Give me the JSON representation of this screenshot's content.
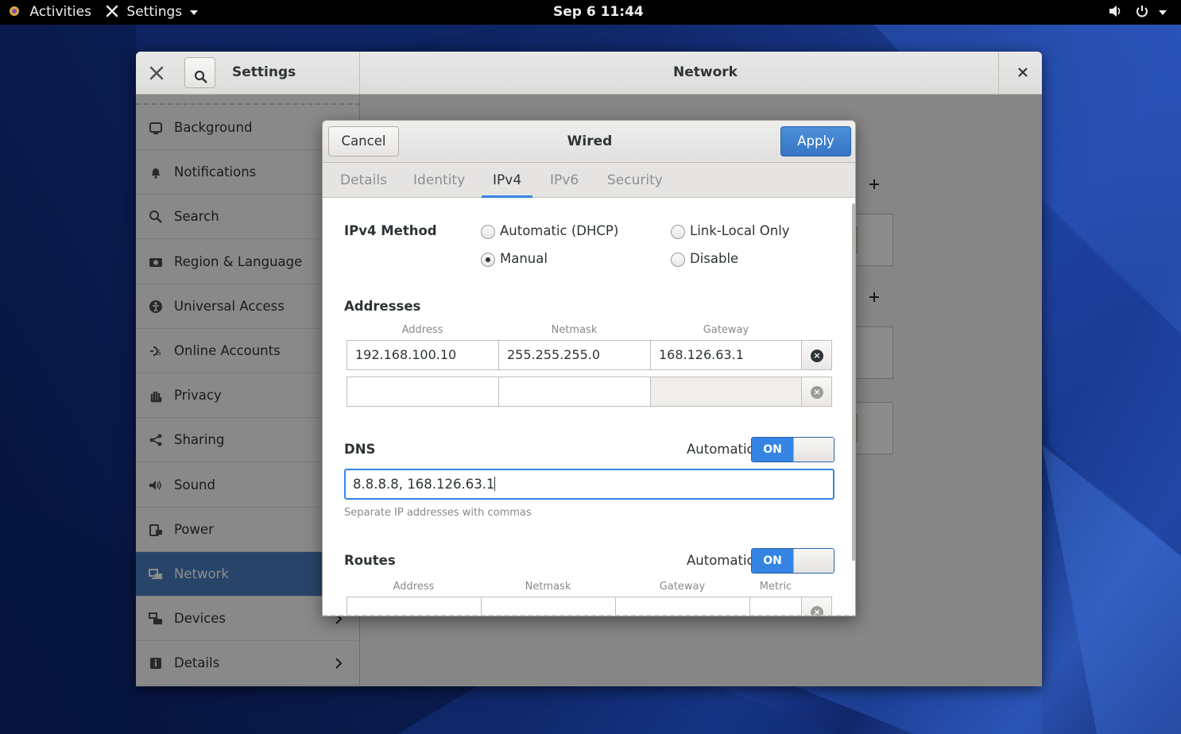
{
  "topbar": {
    "activities": "Activities",
    "app_menu": "Settings",
    "clock": "Sep 6  11:44"
  },
  "settings": {
    "title": "Settings",
    "panel_title": "Network",
    "sidebar": [
      {
        "label": "Background",
        "icon": "background-icon"
      },
      {
        "label": "Notifications",
        "icon": "bell-icon"
      },
      {
        "label": "Search",
        "icon": "search-icon"
      },
      {
        "label": "Region & Language",
        "icon": "region-icon"
      },
      {
        "label": "Universal Access",
        "icon": "accessibility-icon"
      },
      {
        "label": "Online Accounts",
        "icon": "online-accounts-icon"
      },
      {
        "label": "Privacy",
        "icon": "hand-icon"
      },
      {
        "label": "Sharing",
        "icon": "share-icon"
      },
      {
        "label": "Sound",
        "icon": "speaker-icon"
      },
      {
        "label": "Power",
        "icon": "power-icon"
      },
      {
        "label": "Network",
        "icon": "network-icon",
        "active": true
      },
      {
        "label": "Devices",
        "icon": "devices-icon"
      },
      {
        "label": "Details",
        "icon": "info-icon"
      }
    ]
  },
  "dialog": {
    "title": "Wired",
    "cancel": "Cancel",
    "apply": "Apply",
    "tabs": [
      "Details",
      "Identity",
      "IPv4",
      "IPv6",
      "Security"
    ],
    "active_tab": "IPv4",
    "ipv4_method_label": "IPv4 Method",
    "methods": {
      "automatic": "Automatic (DHCP)",
      "link_local": "Link-Local Only",
      "manual": "Manual",
      "disable": "Disable"
    },
    "selected_method": "Manual",
    "addresses_label": "Addresses",
    "address_columns": [
      "Address",
      "Netmask",
      "Gateway"
    ],
    "address_rows": [
      [
        "192.168.100.10",
        "255.255.255.0",
        "168.126.63.1"
      ],
      [
        "",
        "",
        ""
      ]
    ],
    "dns_label": "DNS",
    "automatic_label": "Automatic",
    "switch_on": "ON",
    "dns_value": "8.8.8.8, 168.126.63.1",
    "dns_hint": "Separate IP addresses with commas",
    "routes_label": "Routes",
    "route_columns": [
      "Address",
      "Netmask",
      "Gateway",
      "Metric"
    ]
  },
  "colors": {
    "accent": "#3584e4",
    "sidebar_active": "#4a7fbf"
  }
}
